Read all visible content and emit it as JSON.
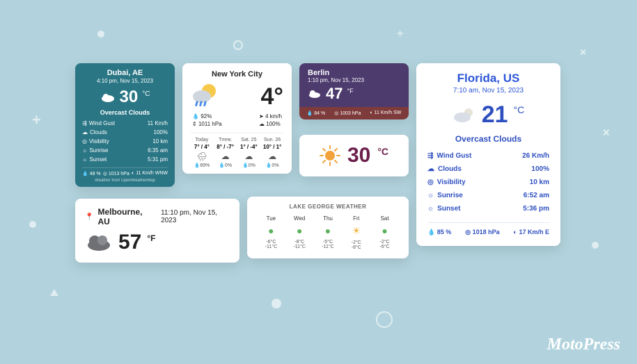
{
  "brand": "MotoPress",
  "dubai": {
    "location": "Dubai, AE",
    "datetime": "4:10 pm, Nov 15, 2023",
    "temp": "30",
    "unit": "°C",
    "condition": "Overcast Clouds",
    "rows": [
      {
        "label": "Wind Gust",
        "value": "11 Km/h"
      },
      {
        "label": "Clouds",
        "value": "100%"
      },
      {
        "label": "Visibility",
        "value": "10 km"
      },
      {
        "label": "Sunrise",
        "value": "6:35 am"
      },
      {
        "label": "Sunset",
        "value": "5:31 pm"
      }
    ],
    "footer": {
      "humidity": "48 %",
      "pressure": "1013 hPa",
      "wind": "11 Km/h WNW"
    },
    "attrib": "Weather from OpenWeatherMap"
  },
  "nyc": {
    "location": "New York City",
    "temp": "4°",
    "stats": {
      "humidity": "92%",
      "pressure": "1011 hPa",
      "wind": "4 km/h",
      "clouds": "100%"
    },
    "forecast": [
      {
        "name": "Today",
        "hl": "7° / 4°",
        "pop": "89%"
      },
      {
        "name": "Tmrw.",
        "hl": "8° / -7°",
        "pop": "0%"
      },
      {
        "name": "Sat. 25",
        "hl": "1° / -4°",
        "pop": "0%"
      },
      {
        "name": "Sun. 26",
        "hl": "10° / 1°",
        "pop": "0%"
      }
    ]
  },
  "berlin": {
    "location": "Berlin",
    "datetime": "1:10 pm, Nov 15, 2023",
    "temp": "47",
    "unit": "°F",
    "footer": {
      "humidity": "84 %",
      "pressure": "1003 hPa",
      "wind": "11 Km/h SW"
    }
  },
  "sun": {
    "temp": "30",
    "unit": "°C"
  },
  "florida": {
    "location": "Florida, US",
    "datetime": "7:10 am, Nov 15, 2023",
    "temp": "21",
    "unit": "°C",
    "condition": "Overcast Clouds",
    "rows": [
      {
        "label": "Wind Gust",
        "value": "26 Km/h"
      },
      {
        "label": "Clouds",
        "value": "100%"
      },
      {
        "label": "Visibility",
        "value": "10 km"
      },
      {
        "label": "Sunrise",
        "value": "6:52 am"
      },
      {
        "label": "Sunset",
        "value": "5:36 pm"
      }
    ],
    "footer": {
      "humidity": "85 %",
      "pressure": "1018 hPa",
      "wind": "17 Km/h E"
    }
  },
  "melbourne": {
    "location": "Melbourne, AU",
    "datetime": "11:10 pm, Nov 15, 2023",
    "temp": "57",
    "unit": "°F"
  },
  "lakegeorge": {
    "title": "LAKE GEORGE WEATHER",
    "days": [
      {
        "name": "Tue",
        "hi": "-6°C",
        "lo": "-11°C",
        "sunny": false
      },
      {
        "name": "Wed",
        "hi": "-8°C",
        "lo": "-11°C",
        "sunny": false
      },
      {
        "name": "Thu",
        "hi": "-5°C",
        "lo": "-11°C",
        "sunny": false
      },
      {
        "name": "Fri",
        "hi": "-2°C",
        "lo": "-8°C",
        "sunny": true
      },
      {
        "name": "Sat",
        "hi": "-2°C",
        "lo": "-6°C",
        "sunny": false
      }
    ]
  }
}
